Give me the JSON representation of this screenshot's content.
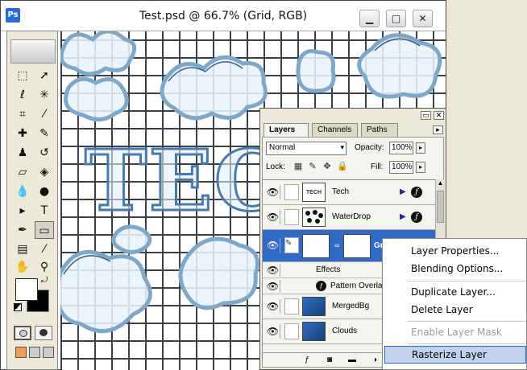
{
  "window": {
    "title": "Test.psd @ 66.7% (Grid, RGB)",
    "app_icon": "Ps",
    "min_icon": "minimize-icon",
    "max_icon": "maximize-icon",
    "close_icon": "close-icon"
  },
  "canvas_text": "TECH",
  "tools": [
    "marquee-tool",
    "move-tool",
    "lasso-tool",
    "magic-wand-tool",
    "crop-tool",
    "slice-tool",
    "healing-brush-tool",
    "brush-tool",
    "clone-stamp-tool",
    "history-brush-tool",
    "eraser-tool",
    "paint-bucket-tool",
    "blur-tool",
    "dodge-tool",
    "path-selection-tool",
    "type-tool",
    "pen-tool",
    "rectangle-tool",
    "notes-tool",
    "eyedropper-tool",
    "hand-tool",
    "zoom-tool"
  ],
  "colors": {
    "foreground": "#ffffff",
    "background": "#000000",
    "selection": "#316ac5"
  },
  "layers_panel": {
    "tabs": [
      "Layers",
      "Channels",
      "Paths"
    ],
    "blend_mode": "Normal",
    "opacity_label": "Opacity:",
    "opacity": "100%",
    "lock_label": "Lock:",
    "fill_label": "Fill:",
    "fill": "100%",
    "layers": [
      {
        "name": "Tech",
        "thumb": "TECH"
      },
      {
        "name": "WaterDrop"
      },
      {
        "name": "Grid",
        "selected": true
      },
      {
        "name": "MergedBg"
      },
      {
        "name": "Clouds"
      }
    ],
    "effects_label": "Effects",
    "effect": "Pattern Overla"
  },
  "context_menu": {
    "items": [
      "Layer Properties...",
      "Blending Options...",
      "Duplicate Layer...",
      "Delete Layer",
      "Enable Layer Mask",
      "Rasterize Layer"
    ],
    "disabled": [
      "Enable Layer Mask"
    ],
    "highlighted": "Rasterize Layer"
  }
}
